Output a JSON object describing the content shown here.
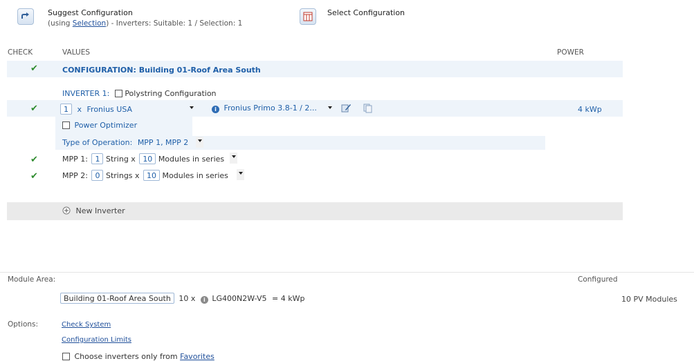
{
  "toolbar": {
    "suggest_title": "Suggest Configuration",
    "suggest_sub_prefix": "(using ",
    "suggest_sub_link": "Selection",
    "suggest_sub_suffix": ") - Inverters: Suitable: 1 / Selection: 1",
    "select_title": "Select Configuration"
  },
  "table_headers": {
    "check": "CHECK",
    "values": "VALUES",
    "power": "POWER"
  },
  "configuration": {
    "title": "CONFIGURATION: Building 01-Roof Area South"
  },
  "inverter": {
    "label": "INVERTER 1:",
    "polystring_label": "Polystring Configuration",
    "quantity": "1",
    "times": "x",
    "manufacturer": "Fronius USA",
    "model": "Fronius Primo 3.8-1 / 2...",
    "power": "4 kWp",
    "power_optimizer_label": "Power Optimizer",
    "type_of_operation_label": "Type of Operation:",
    "type_of_operation_value": "MPP 1, MPP 2"
  },
  "mpp": [
    {
      "label": "MPP 1:",
      "strings": "1",
      "strings_label": "String x",
      "modules": "10",
      "modules_label": "Modules in series"
    },
    {
      "label": "MPP 2:",
      "strings": "0",
      "strings_label": "Strings x",
      "modules": "10",
      "modules_label": "Modules in series"
    }
  ],
  "new_inverter_label": "New Inverter",
  "module_area": {
    "label": "Module Area:",
    "configured_label": "Configured",
    "area_name": "Building 01-Roof Area South",
    "count_text": "10  x",
    "module_name": "LG400N2W-V5",
    "equals_text": "=  4 kWp",
    "configured_value": "10 PV Modules"
  },
  "options": {
    "label": "Options:",
    "check_system": "Check System",
    "configuration_limits": "Configuration Limits",
    "favorites_prefix": "Choose inverters only from ",
    "favorites_link": "Favorites"
  },
  "colors": {
    "accent_blue": "#1f5fa8",
    "check_green": "#2e8b2e",
    "band_blue": "#eef4fa",
    "band_gray": "#eaeaea"
  }
}
